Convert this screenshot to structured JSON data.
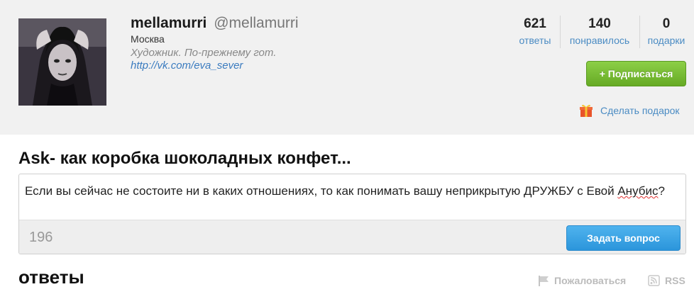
{
  "profile": {
    "name": "mellamurri",
    "handle": "@mellamurri",
    "city": "Москва",
    "bio": "Художник. По-прежнему гот.",
    "link": "http://vk.com/eva_sever",
    "avatar_icon": "profile-photo"
  },
  "stats": [
    {
      "value": "621",
      "label": "ответы"
    },
    {
      "value": "140",
      "label": "понравилось"
    },
    {
      "value": "0",
      "label": "подарки"
    }
  ],
  "actions": {
    "follow_label": "+ Подписаться",
    "gift_label": "Сделать подарок",
    "gift_icon": "gift-icon"
  },
  "ask": {
    "title": "Ask- как коробка шоколадных конфет...",
    "question_part1": "Если вы сейчас не состоите ни в каких отношениях, то как понимать вашу неприкрытую ДРУЖБУ с Евой ",
    "question_misspelled": "Анубис",
    "question_part2": "?",
    "char_count": "196",
    "submit_label": "Задать вопрос"
  },
  "answers": {
    "title": "ответы",
    "report_label": "Пожаловаться",
    "rss_label": "RSS"
  },
  "colors": {
    "accent_link": "#4a8bc3",
    "follow_green": "#7bbf3a",
    "ask_blue": "#36a2e4"
  }
}
